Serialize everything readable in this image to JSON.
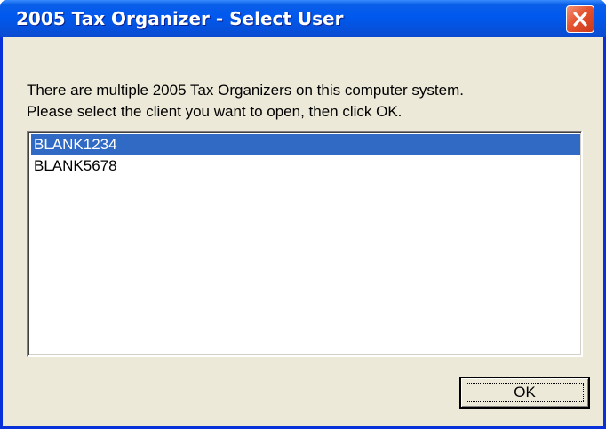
{
  "window": {
    "title": "2005 Tax Organizer - Select User"
  },
  "message": {
    "line1": "There are multiple 2005 Tax Organizers on this computer system.",
    "line2": "Please select the client you want to open, then click OK."
  },
  "client_list": {
    "items": [
      {
        "label": "BLANK1234",
        "selected": true
      },
      {
        "label": "BLANK5678",
        "selected": false
      }
    ]
  },
  "buttons": {
    "ok_label": "OK",
    "close_icon": "close-icon"
  },
  "colors": {
    "title_bar": "#0058EE",
    "close_button": "#E5532F",
    "selection": "#316AC5",
    "dialog_background": "#ECE9D8"
  }
}
